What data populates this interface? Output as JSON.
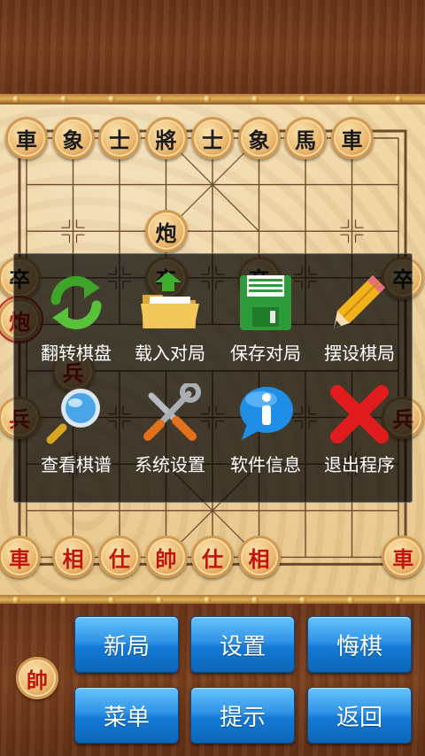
{
  "board": {
    "pieces": [
      {
        "text": "車",
        "side": "black",
        "col": 0,
        "row": 0
      },
      {
        "text": "象",
        "side": "black",
        "col": 1,
        "row": 0
      },
      {
        "text": "士",
        "side": "black",
        "col": 2,
        "row": 0
      },
      {
        "text": "將",
        "side": "black",
        "col": 3,
        "row": 0
      },
      {
        "text": "士",
        "side": "black",
        "col": 4,
        "row": 0
      },
      {
        "text": "象",
        "side": "black",
        "col": 5,
        "row": 0
      },
      {
        "text": "馬",
        "side": "black",
        "col": 6,
        "row": 0
      },
      {
        "text": "車",
        "side": "black",
        "col": 7,
        "row": 0
      },
      {
        "text": "炮",
        "side": "black",
        "col": 3,
        "row": 2
      },
      {
        "text": "卒",
        "side": "black",
        "col": -0.15,
        "row": 3
      },
      {
        "text": "卒",
        "side": "black",
        "col": 3,
        "row": 3
      },
      {
        "text": "卒",
        "side": "black",
        "col": 5,
        "row": 3
      },
      {
        "text": "卒",
        "side": "black",
        "col": 8.1,
        "row": 3
      },
      {
        "text": "炮",
        "side": "red",
        "col": -0.15,
        "row": 3.9,
        "selected": true
      },
      {
        "text": "兵",
        "side": "red",
        "col": 1,
        "row": 5
      },
      {
        "text": "兵",
        "side": "red",
        "col": -0.15,
        "row": 6
      },
      {
        "text": "兵",
        "side": "red",
        "col": 8.1,
        "row": 6
      },
      {
        "text": "車",
        "side": "red",
        "col": -0.15,
        "row": 9
      },
      {
        "text": "相",
        "side": "red",
        "col": 1,
        "row": 9
      },
      {
        "text": "仕",
        "side": "red",
        "col": 2,
        "row": 9
      },
      {
        "text": "帥",
        "side": "red",
        "col": 3,
        "row": 9
      },
      {
        "text": "仕",
        "side": "red",
        "col": 4,
        "row": 9
      },
      {
        "text": "相",
        "side": "red",
        "col": 5,
        "row": 9
      },
      {
        "text": "車",
        "side": "red",
        "col": 8.1,
        "row": 9
      }
    ]
  },
  "menu": {
    "items": [
      {
        "label": "翻转棋盘",
        "icon": "rotate-arrows-icon"
      },
      {
        "label": "载入对局",
        "icon": "folder-upload-icon"
      },
      {
        "label": "保存对局",
        "icon": "floppy-disk-icon"
      },
      {
        "label": "摆设棋局",
        "icon": "pencil-icon"
      },
      {
        "label": "查看棋谱",
        "icon": "magnifier-icon"
      },
      {
        "label": "系统设置",
        "icon": "tools-icon"
      },
      {
        "label": "软件信息",
        "icon": "info-bubble-icon"
      },
      {
        "label": "退出程序",
        "icon": "red-x-icon"
      }
    ]
  },
  "turn_indicator": {
    "text": "帥",
    "side": "red"
  },
  "buttons": {
    "new_game": "新局",
    "settings": "设置",
    "undo": "悔棋",
    "menu": "菜单",
    "hint": "提示",
    "back": "返回"
  }
}
